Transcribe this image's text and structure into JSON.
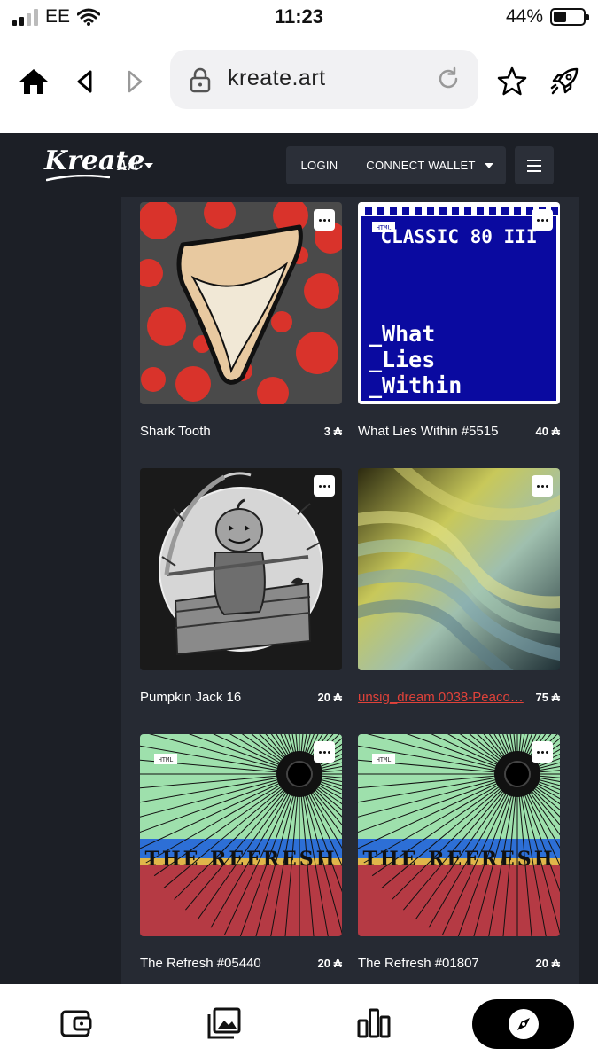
{
  "status_bar": {
    "carrier": "EE",
    "time": "11:23",
    "battery": "44%",
    "battery_level": 0.44
  },
  "browser": {
    "url": "kreate.art"
  },
  "header": {
    "logo": "Kreate",
    "selector": "Art",
    "login_label": "LOGIN",
    "wallet_label": "CONNECT WALLET"
  },
  "nfts": [
    {
      "name": "Shark Tooth",
      "price": "3 ₳"
    },
    {
      "name": "What Lies Within #5515",
      "price": "40 ₳",
      "art_title": "CLASSIC 80 III",
      "art_lines": [
        "_What",
        "_Lies",
        "_Within"
      ],
      "badge": "HTML"
    },
    {
      "name": "Pumpkin Jack 16",
      "price": "20 ₳"
    },
    {
      "name": "unsig_dream 0038-Peaco…",
      "price": "75 ₳"
    },
    {
      "name": "The Refresh #05440",
      "price": "20 ₳",
      "art_title": "THE REFRESH",
      "badge": "HTML"
    },
    {
      "name": "The Refresh #01807",
      "price": "20 ₳",
      "art_title": "THE REFRESH",
      "badge": "HTML"
    }
  ],
  "colors": {
    "bg": "#1c1f26",
    "panel": "#262a33",
    "link": "#e0423a",
    "accent_blue": "#0a0aa0"
  },
  "icons": [
    "home-icon",
    "back-icon",
    "forward-icon",
    "lock-icon",
    "reload-icon",
    "star-icon",
    "rocket-icon",
    "wallet-icon",
    "gallery-icon",
    "chart-icon",
    "compass-icon"
  ]
}
